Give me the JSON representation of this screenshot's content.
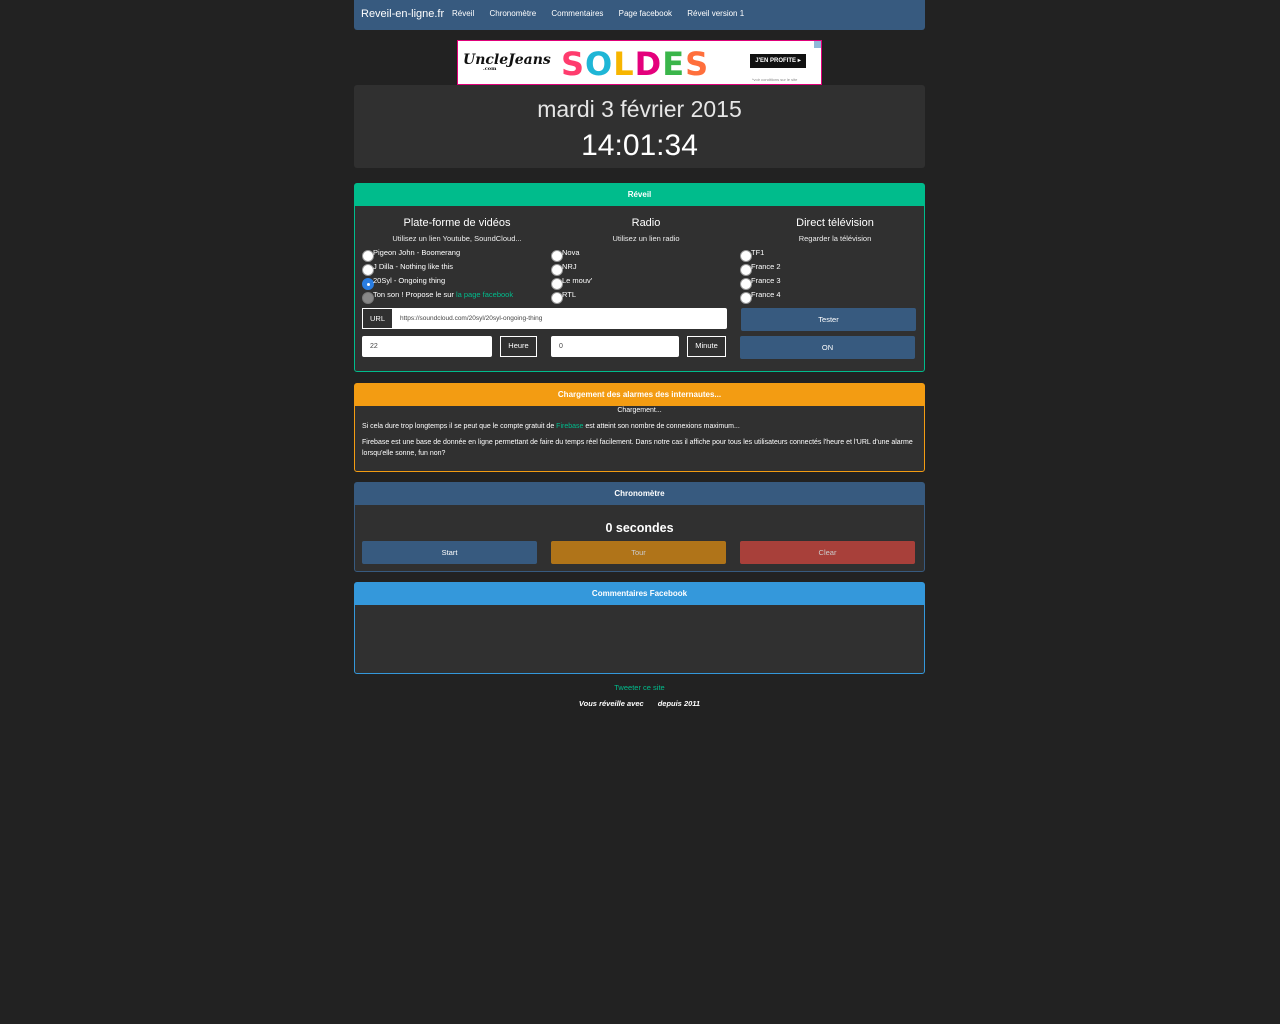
{
  "nav": {
    "brand": "Reveil-en-ligne.fr",
    "links": [
      "Réveil",
      "Chronomètre",
      "Commentaires",
      "Page facebook",
      "Réveil version 1"
    ]
  },
  "ad": {
    "logo": "UncleJeans",
    "logo_sub": ".com",
    "headline_letters": [
      "S",
      "O",
      "L",
      "D",
      "E",
      "S"
    ],
    "cta": "J'EN PROFITE ▸",
    "conditions": "*voir conditions sur le site"
  },
  "clock": {
    "date": "mardi 3 février 2015",
    "time": "14:01:34"
  },
  "reveil": {
    "title": "Réveil",
    "videos": {
      "heading": "Plate-forme de vidéos",
      "sub": "Utilisez un lien Youtube, SoundCloud...",
      "options": [
        "Pigeon John - Boomerang",
        "J Dilla - Nothing like this",
        "20Syl - Ongoing thing",
        "Ton son ! Propose le sur "
      ],
      "facebook_link": "la page facebook",
      "checked_index": 2
    },
    "radio": {
      "heading": "Radio",
      "sub": "Utilisez un lien radio",
      "options": [
        "Nova",
        "NRJ",
        "Le mouv'",
        "RTL"
      ]
    },
    "tv": {
      "heading": "Direct télévision",
      "sub": "Regarder la télévision",
      "options": [
        "TF1",
        "France 2",
        "France 3",
        "France 4"
      ]
    },
    "url_label": "URL",
    "url_value": "https://soundcloud.com/20syl/20syl-ongoing-thing",
    "hour_value": "22",
    "hour_label": "Heure",
    "minute_value": "0",
    "minute_label": "Minute",
    "test_button": "Tester",
    "on_button": "ON"
  },
  "alarms": {
    "title": "Chargement des alarmes des internautes...",
    "loading": "Chargement...",
    "line1_a": "Si cela dure trop longtemps il se peut que le compte gratuit de ",
    "line1_link": "Firebase",
    "line1_b": " est atteint son nombre de connexions maximum...",
    "line2": "Firebase est une base de donnée en ligne permettant de faire du temps réel facilement. Dans notre cas il affiche pour tous les utilisateurs connectés l'heure et l'URL d'une alarme lorsqu'elle sonne, fun non?"
  },
  "chrono": {
    "title": "Chronomètre",
    "value": "0 secondes",
    "start": "Start",
    "tour": "Tour",
    "clear": "Clear"
  },
  "comments": {
    "title": "Commentaires Facebook"
  },
  "footer": {
    "tweet": "Tweeter ce site",
    "since_a": "Vous réveille avec",
    "since_b": "depuis 2011"
  },
  "colors": {
    "background": "#222222",
    "primary": "#375a7f",
    "success": "#00bc8c",
    "warning": "#f39c12",
    "danger": "#e74c3c",
    "info": "#3498db"
  }
}
